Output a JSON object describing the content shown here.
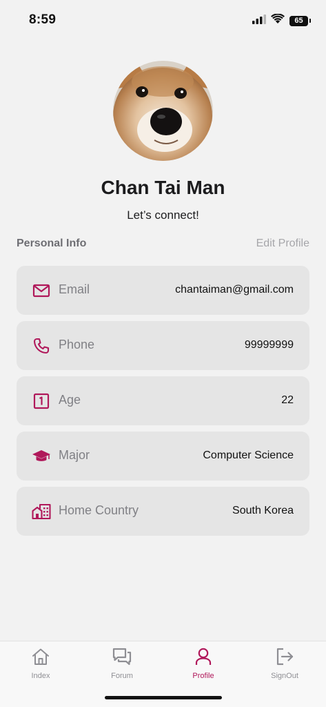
{
  "status_bar": {
    "time": "8:59",
    "battery": "65",
    "battery_percent": 65,
    "icons": [
      "cellular-signal-icon",
      "wifi-icon",
      "battery-icon"
    ]
  },
  "profile": {
    "avatar": "shiba-inu-dog-photo",
    "name": "Chan Tai Man",
    "tagline": "Let’s connect!"
  },
  "section": {
    "title": "Personal Info",
    "edit_label": "Edit Profile"
  },
  "info_items": [
    {
      "label": "Email",
      "value": "chantaiman@gmail.com",
      "icon": "mail-icon"
    },
    {
      "label": "Phone",
      "value": "99999999",
      "icon": "phone-icon"
    },
    {
      "label": "Age",
      "value": "22",
      "icon": "number-one-box-icon"
    },
    {
      "label": "Major",
      "value": "Computer Science",
      "icon": "graduation-cap-icon"
    },
    {
      "label": "Home Country",
      "value": "South Korea",
      "icon": "home-city-icon"
    }
  ],
  "tabs": [
    {
      "label": "Index",
      "icon": "home-icon",
      "active": false
    },
    {
      "label": "Forum",
      "icon": "forum-icon",
      "active": false
    },
    {
      "label": "Profile",
      "icon": "account-icon",
      "active": true
    },
    {
      "label": "SignOut",
      "icon": "logout-icon",
      "active": false
    }
  ],
  "colors": {
    "accent": "#b0185a",
    "background": "#f2f2f2",
    "card": "#e5e5e5",
    "label": "#808085",
    "inactive_tab": "#8e8e93"
  }
}
